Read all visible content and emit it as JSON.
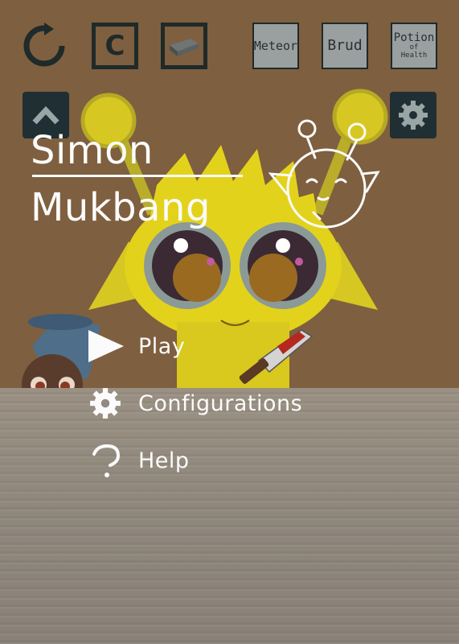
{
  "toolbar": {
    "restart_icon": "restart-icon",
    "c_label": "C",
    "bar_icon": "metal-bar-icon",
    "items": [
      {
        "label": "Meteor"
      },
      {
        "label": "Brud"
      }
    ],
    "potion": {
      "line1": "Potion",
      "line2": "of",
      "line3": "Health"
    }
  },
  "collapse_icon": "chevron-up-icon",
  "settings_icon": "gear-icon",
  "title": {
    "line1": "Simon",
    "line2": "Mukbang"
  },
  "menu": {
    "play": "Play",
    "configurations": "Configurations",
    "help": "Help"
  },
  "colors": {
    "wall": "#7e5f3f",
    "table": "#918a80",
    "creature": "#e3d21c",
    "dark_button": "#1f2f33",
    "text": "#fbfbfb"
  }
}
